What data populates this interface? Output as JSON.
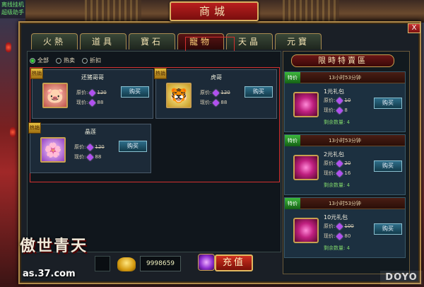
{
  "scene": {
    "topleft_text": "离线挂机\n超级助手"
  },
  "shop": {
    "title": "商城",
    "close": "X",
    "tabs": [
      "火熱",
      "道具",
      "寶石",
      "寵物",
      "天晶",
      "元寶"
    ],
    "active_tab": "寵物",
    "filters": [
      {
        "label": "全部",
        "checked": true
      },
      {
        "label": "热卖",
        "checked": false
      },
      {
        "label": "折扣",
        "checked": false
      }
    ]
  },
  "items": [
    {
      "badge": "热销",
      "name": "还猪哥哥",
      "icon": "🐷",
      "orig_label": "原价:",
      "orig": "120",
      "now_label": "现价:",
      "now": "88",
      "buy": "购买"
    },
    {
      "badge": "热销",
      "name": "虎哥",
      "icon": "🐯",
      "orig_label": "原价:",
      "orig": "120",
      "now_label": "现价:",
      "now": "88",
      "buy": "购买"
    },
    {
      "badge": "热销",
      "name": "晶莲",
      "icon": "🌸",
      "orig_label": "原价:",
      "orig": "120",
      "now_label": "现价:",
      "now": "88",
      "buy": "购买"
    }
  ],
  "bottom": {
    "gold": "9998659",
    "recharge": "充值"
  },
  "logo": {
    "title": "傲世青天",
    "url": "as.37.com"
  },
  "limited": {
    "title": "限時特賣區",
    "offers": [
      {
        "tag": "特价",
        "timer": "13小时53分钟",
        "name": "1元礼包",
        "orig_label": "原价:",
        "orig": "10",
        "now_label": "现价:",
        "now": "8",
        "remain": "剩余数量: 4",
        "buy": "购买"
      },
      {
        "tag": "特价",
        "timer": "13小时53分钟",
        "name": "2元礼包",
        "orig_label": "原价:",
        "orig": "20",
        "now_label": "现价:",
        "now": "16",
        "remain": "剩余数量: 4",
        "buy": "购买"
      },
      {
        "tag": "特价",
        "timer": "13小时53分钟",
        "name": "10元礼包",
        "orig_label": "原价:",
        "orig": "100",
        "now_label": "现价:",
        "now": "80",
        "remain": "剩余数量: 4",
        "buy": "购买"
      }
    ]
  },
  "watermark": "DOYO"
}
